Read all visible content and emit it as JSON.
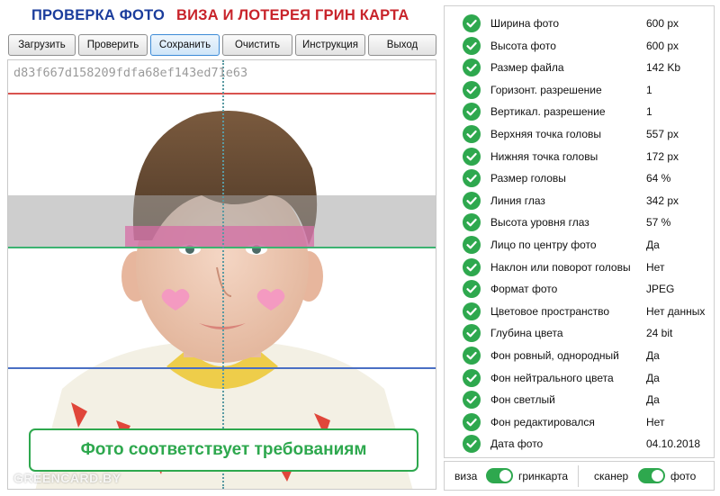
{
  "header": {
    "title_left": "ПРОВЕРКА ФОТО",
    "title_right": "ВИЗА И ЛОТЕРЕЯ ГРИН КАРТА"
  },
  "toolbar": {
    "buttons": [
      {
        "label": "Загрузить"
      },
      {
        "label": "Проверить"
      },
      {
        "label": "Сохранить"
      },
      {
        "label": "Очистить"
      },
      {
        "label": "Инструкция"
      },
      {
        "label": "Выход"
      }
    ]
  },
  "photo": {
    "id": "d83f667d158209fdfa68ef143ed71e63",
    "watermark": "GREENCARD.BY",
    "result_message": "Фото соответствует требованиям"
  },
  "colors": {
    "accent_green": "#2ea84e",
    "title_blue": "#1b3d9c",
    "title_red": "#c8232a",
    "line_red": "#d9534f",
    "line_green": "#3cb371",
    "line_blue": "#4a6fc4"
  },
  "results": {
    "rows": [
      {
        "label": "Ширина фото",
        "value": "600 px",
        "icon": "check-circle-icon"
      },
      {
        "label": "Высота фото",
        "value": "600 px",
        "icon": "check-circle-icon"
      },
      {
        "label": "Размер файла",
        "value": "142 Kb",
        "icon": "check-circle-icon"
      },
      {
        "label": "Горизонт. разрешение",
        "value": "1",
        "icon": "check-circle-icon"
      },
      {
        "label": "Вертикал. разрешение",
        "value": "1",
        "icon": "check-circle-icon"
      },
      {
        "label": "Верхняя точка головы",
        "value": "557 px",
        "icon": "check-circle-icon"
      },
      {
        "label": "Нижняя точка головы",
        "value": "172 px",
        "icon": "check-circle-icon"
      },
      {
        "label": "Размер головы",
        "value": "64 %",
        "icon": "check-circle-icon"
      },
      {
        "label": "Линия глаз",
        "value": "342 px",
        "icon": "check-circle-icon"
      },
      {
        "label": "Высота уровня глаз",
        "value": "57 %",
        "icon": "check-circle-icon"
      },
      {
        "label": "Лицо по центру фото",
        "value": "Да",
        "icon": "check-circle-icon"
      },
      {
        "label": "Наклон или поворот головы",
        "value": "Нет",
        "icon": "check-circle-icon"
      },
      {
        "label": "Формат фото",
        "value": "JPEG",
        "icon": "check-circle-icon"
      },
      {
        "label": "Цветовое пространство",
        "value": "Нет данных",
        "icon": "check-circle-icon"
      },
      {
        "label": "Глубина цвета",
        "value": "24 bit",
        "icon": "check-circle-icon"
      },
      {
        "label": "Фон ровный, однородный",
        "value": "Да",
        "icon": "check-circle-icon"
      },
      {
        "label": "Фон нейтрального цвета",
        "value": "Да",
        "icon": "check-circle-icon"
      },
      {
        "label": "Фон светлый",
        "value": "Да",
        "icon": "check-circle-icon"
      },
      {
        "label": "Фон редактировался",
        "value": "Нет",
        "icon": "check-circle-icon"
      },
      {
        "label": "Дата фото",
        "value": "04.10.2018",
        "icon": "check-circle-icon"
      }
    ]
  },
  "toggles": {
    "visa_label": "виза",
    "greencard_label": "гринкарта",
    "scanner_label": "сканер",
    "photo_label": "фото"
  }
}
